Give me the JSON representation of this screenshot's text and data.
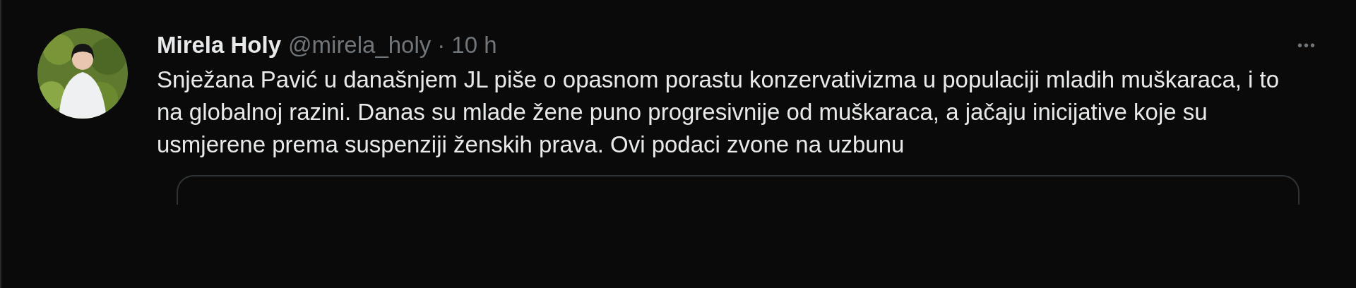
{
  "tweet": {
    "author_name": "Mirela Holy",
    "handle": "@mirela_holy",
    "separator": "·",
    "time": "10 h",
    "more": "•••",
    "text": "Snježana Pavić u današnjem JL piše o opasnom porastu konzervativizma u populaciji mladih muškaraca, i to na globalnoj razini. Danas su mlade žene puno progresivnije od muškaraca, a jačaju inicijative koje su usmjerene prema suspenziji ženskih prava. Ovi podaci zvone na uzbunu"
  }
}
